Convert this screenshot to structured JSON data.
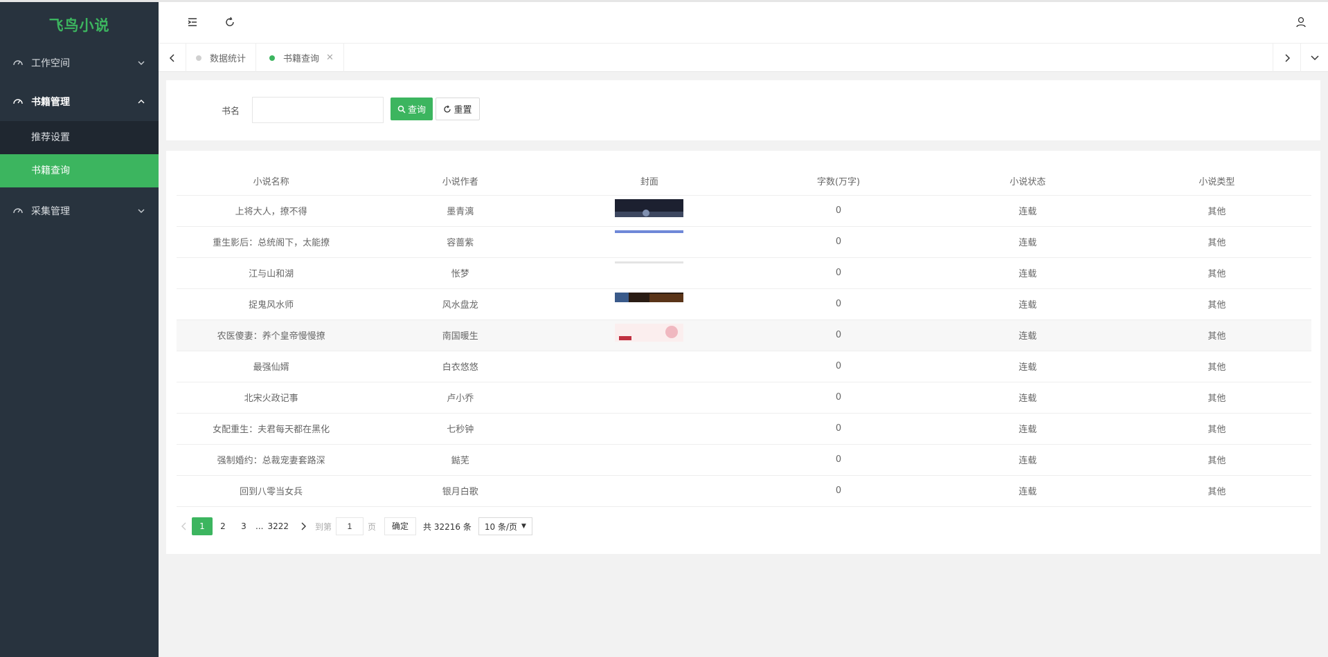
{
  "app": {
    "logo": "飞鸟小说"
  },
  "sidebar": {
    "groups": [
      {
        "label": "工作空间",
        "icon": "dashboard-icon",
        "expanded": false
      },
      {
        "label": "书籍管理",
        "icon": "dashboard-icon",
        "expanded": true,
        "children": [
          {
            "label": "推荐设置",
            "selected": false
          },
          {
            "label": "书籍查询",
            "selected": true
          }
        ]
      },
      {
        "label": "采集管理",
        "icon": "dashboard-icon",
        "expanded": false
      }
    ]
  },
  "topbar": {
    "icons": [
      "menu-collapse-icon",
      "refresh-icon",
      "user-icon"
    ]
  },
  "tabs": [
    {
      "label": "数据统计",
      "active": false
    },
    {
      "label": "书籍查询",
      "active": true,
      "closable": true
    }
  ],
  "search": {
    "label": "书名",
    "value": "",
    "query_label": "查询",
    "reset_label": "重置"
  },
  "table": {
    "headers": [
      "小说名称",
      "小说作者",
      "封面",
      "字数(万字)",
      "小说状态",
      "小说类型"
    ],
    "rows": [
      {
        "name": "上将大人，撩不得",
        "author": "墨青漓",
        "cover": "cover-dark",
        "words": "0",
        "status": "连载",
        "type": "其他"
      },
      {
        "name": "重生影后：总统阁下，太能撩",
        "author": "容蔷紫",
        "cover": "cover-blue-line",
        "words": "0",
        "status": "连载",
        "type": "其他"
      },
      {
        "name": "江与山和湖",
        "author": "怅梦",
        "cover": "cover-light-line",
        "words": "0",
        "status": "连载",
        "type": "其他"
      },
      {
        "name": "捉鬼风水师",
        "author": "风水盘龙",
        "cover": "cover-sunset",
        "words": "0",
        "status": "连载",
        "type": "其他"
      },
      {
        "name": "农医傻妻：养个皇帝慢慢撩",
        "author": "南国暖生",
        "cover": "cover-pink",
        "words": "0",
        "status": "连载",
        "type": "其他"
      },
      {
        "name": "最强仙婿",
        "author": "白衣悠悠",
        "cover": "",
        "words": "0",
        "status": "连载",
        "type": "其他"
      },
      {
        "name": "北宋火政记事",
        "author": "卢小乔",
        "cover": "",
        "words": "0",
        "status": "连载",
        "type": "其他"
      },
      {
        "name": "女配重生：夫君每天都在黑化",
        "author": "七秒钟",
        "cover": "",
        "words": "0",
        "status": "连载",
        "type": "其他"
      },
      {
        "name": "强制婚约：总裁宠妻套路深",
        "author": "鐑芜",
        "cover": "",
        "words": "0",
        "status": "连载",
        "type": "其他"
      },
      {
        "name": "回到八零当女兵",
        "author": "银月白歌",
        "cover": "",
        "words": "0",
        "status": "连载",
        "type": "其他"
      }
    ]
  },
  "pagination": {
    "pages": [
      "1",
      "2",
      "3"
    ],
    "ellipsis": "...",
    "last_page": "3222",
    "goto_prefix": "到第",
    "goto_value": "1",
    "goto_suffix": "页",
    "confirm": "确定",
    "total": "共 32216 条",
    "page_size": "10 条/页"
  },
  "colors": {
    "accent": "#3cb55f",
    "sidebar_bg": "#28333e"
  }
}
